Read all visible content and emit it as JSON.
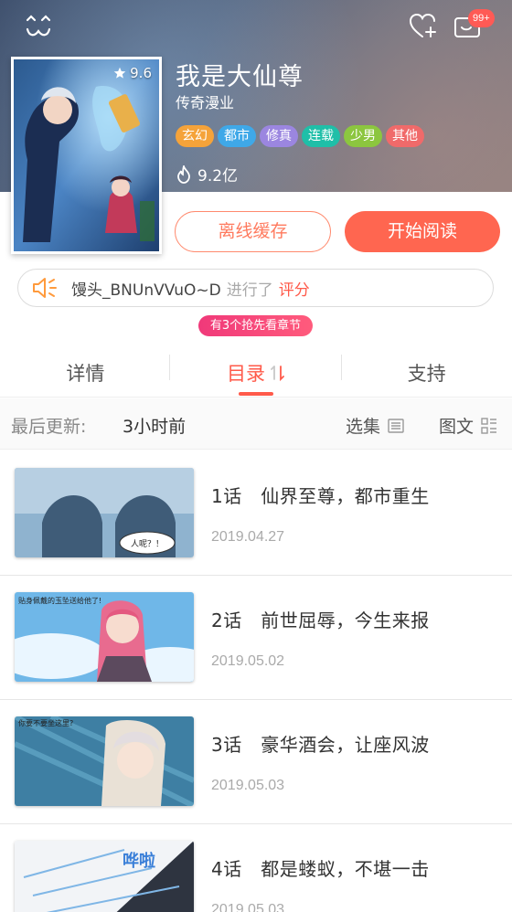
{
  "header": {
    "badge": "99+",
    "title": "我是大仙尊",
    "author": "传奇漫业",
    "tags": [
      {
        "label": "玄幻",
        "color": "#f5a33a"
      },
      {
        "label": "都市",
        "color": "#3fa8e8"
      },
      {
        "label": "修真",
        "color": "#9b86e0"
      },
      {
        "label": "连载",
        "color": "#1fbfa8"
      },
      {
        "label": "少男",
        "color": "#8cc63f"
      },
      {
        "label": "其他",
        "color": "#f06a6a"
      }
    ],
    "popularity": "9.2亿",
    "rating": "9.6"
  },
  "actions": {
    "offline": "离线缓存",
    "read": "开始阅读"
  },
  "activity": {
    "user": "馒头_BNUnVVuO~D",
    "did": "进行了",
    "what": "评分"
  },
  "promo": "有3个抢先看章节",
  "tabs": [
    {
      "label": "详情",
      "active": false
    },
    {
      "label": "目录",
      "active": true
    },
    {
      "label": "支持",
      "active": false
    }
  ],
  "update": {
    "label": "最后更新:",
    "time": "3小时前",
    "select": "选集",
    "mode": "图文"
  },
  "chapters": [
    {
      "title": "1话　仙界至尊，都市重生",
      "date": "2019.04.27",
      "bubble": "人呢？！"
    },
    {
      "title": "2话　前世屈辱，今生来报",
      "date": "2019.05.02",
      "bubble": "贴身佩戴的玉坠送给他了!"
    },
    {
      "title": "3话　豪华酒会，让座风波",
      "date": "2019.05.03",
      "bubble": "你要不要坐这里?"
    },
    {
      "title": "4话　都是蝼蚁，不堪一击",
      "date": "2019.05.03",
      "bubble": "哗啦"
    }
  ],
  "colors": {
    "accent": "#ff5a4a",
    "read_button": "#ff6650",
    "promo": "#f0397a"
  }
}
